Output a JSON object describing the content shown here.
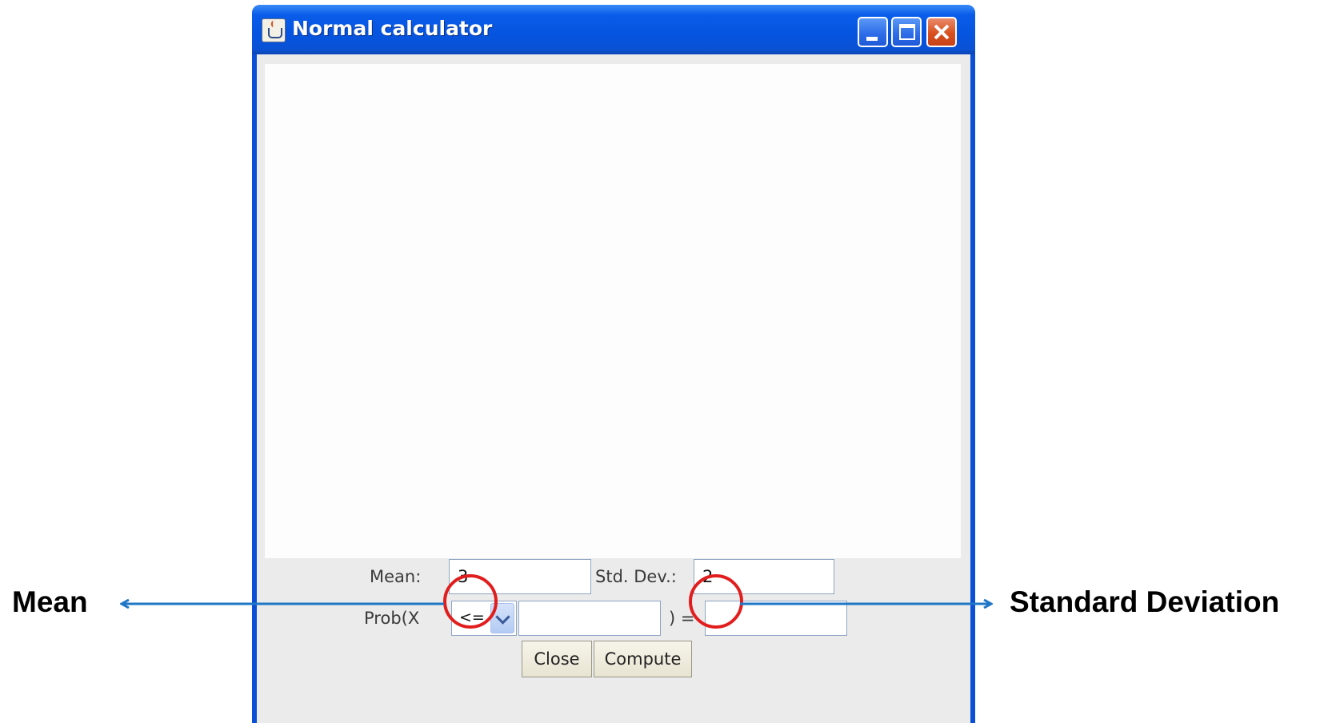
{
  "window": {
    "title": "Normal calculator",
    "accent_color": "#0a4fd6",
    "icons": [
      "java-app-icon",
      "minimize-icon",
      "maximize-icon",
      "close-icon"
    ]
  },
  "form": {
    "mean_label": "Mean:",
    "mean_value": "3",
    "stddev_label": "Std. Dev.:",
    "stddev_value": "2",
    "prob_label": "Prob(X",
    "operator_value": "<=",
    "x_value": "",
    "equals_label": ") =",
    "result_value": ""
  },
  "buttons": {
    "close_label": "Close",
    "compute_label": "Compute"
  },
  "annotations": {
    "mean_callout": "Mean",
    "stddev_callout": "Standard Deviation",
    "highlight_color": "#e11d1d",
    "arrow_color": "#1f77c6"
  }
}
